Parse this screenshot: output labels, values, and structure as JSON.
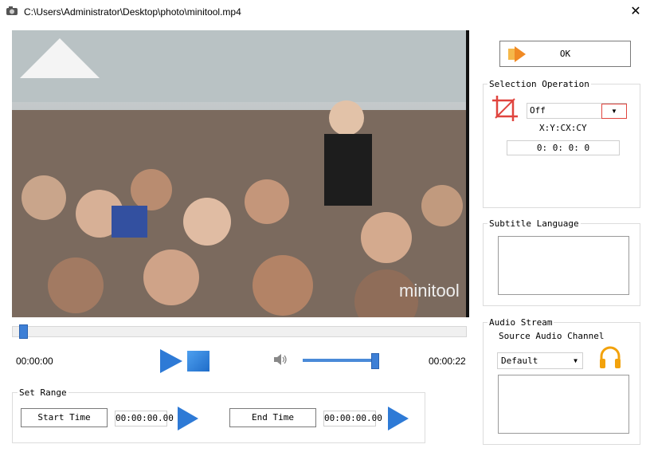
{
  "window": {
    "title": "C:\\Users\\Administrator\\Desktop\\photo\\minitool.mp4",
    "close_glyph": "✕"
  },
  "video": {
    "watermark": "minitool"
  },
  "player": {
    "current_time": "00:00:00",
    "total_time": "00:00:22",
    "volume_percent": 95,
    "seek_fraction": 0
  },
  "ok_button": {
    "label": "OK"
  },
  "selection": {
    "title": "Selection Operation",
    "mode_value": "Off",
    "coords_label": "X:Y:CX:CY",
    "coords_value": "0:  0:  0:  0"
  },
  "subtitle": {
    "title": "Subtitle Language"
  },
  "audio": {
    "title": "Audio Stream",
    "source_label": "Source Audio Channel",
    "channel_value": "Default"
  },
  "set_range": {
    "title": "Set Range",
    "start_label": "Start Time",
    "start_value": "00:00:00.00",
    "end_label": "End Time",
    "end_value": "00:00:00.00"
  },
  "colors": {
    "accent": "#2e7ad6",
    "headphone": "#f2a20c",
    "crop_icon": "#e0443e"
  }
}
